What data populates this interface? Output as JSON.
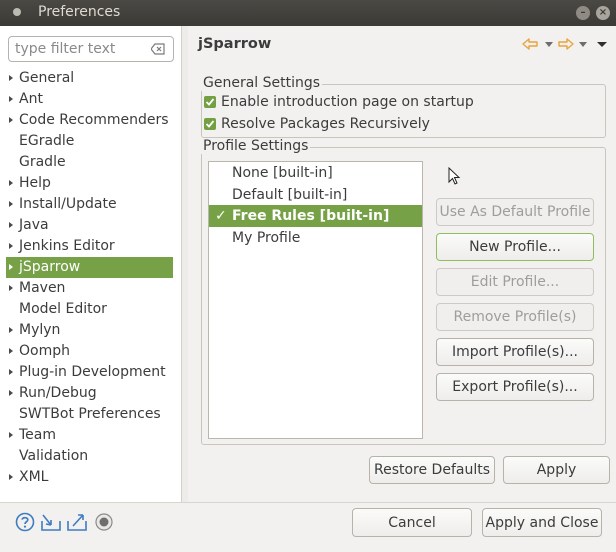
{
  "window": {
    "title": "Preferences"
  },
  "filter": {
    "placeholder": "type filter text"
  },
  "tree": [
    {
      "label": "General",
      "expandable": true
    },
    {
      "label": "Ant",
      "expandable": true
    },
    {
      "label": "Code Recommenders",
      "expandable": true
    },
    {
      "label": "EGradle",
      "expandable": false
    },
    {
      "label": "Gradle",
      "expandable": false
    },
    {
      "label": "Help",
      "expandable": true
    },
    {
      "label": "Install/Update",
      "expandable": true
    },
    {
      "label": "Java",
      "expandable": true
    },
    {
      "label": "Jenkins Editor",
      "expandable": true
    },
    {
      "label": "jSparrow",
      "expandable": true,
      "selected": true
    },
    {
      "label": "Maven",
      "expandable": true
    },
    {
      "label": "Model Editor",
      "expandable": false
    },
    {
      "label": "Mylyn",
      "expandable": true
    },
    {
      "label": "Oomph",
      "expandable": true
    },
    {
      "label": "Plug-in Development",
      "expandable": true
    },
    {
      "label": "Run/Debug",
      "expandable": true
    },
    {
      "label": "SWTBot Preferences",
      "expandable": false
    },
    {
      "label": "Team",
      "expandable": true
    },
    {
      "label": "Validation",
      "expandable": false
    },
    {
      "label": "XML",
      "expandable": true
    }
  ],
  "page": {
    "title": "jSparrow",
    "general_settings": {
      "label": "General Settings",
      "enable_intro_label": "Enable introduction page on startup",
      "resolve_packages_label": "Resolve Packages Recursively"
    },
    "profile_settings": {
      "label": "Profile Settings",
      "profiles": [
        {
          "label": "None [built-in]",
          "selected": false
        },
        {
          "label": "Default [built-in]",
          "selected": false
        },
        {
          "label": "Free Rules [built-in]",
          "selected": true
        },
        {
          "label": "My Profile",
          "selected": false
        }
      ],
      "selected_mark": "✓",
      "buttons": {
        "use_default": "Use As Default Profile",
        "new_profile": "New Profile...",
        "edit_profile": "Edit Profile...",
        "remove_profile": "Remove Profile(s)",
        "import_profile": "Import Profile(s)...",
        "export_profile": "Export Profile(s)..."
      }
    },
    "restore_defaults": "Restore Defaults",
    "apply": "Apply"
  },
  "footer": {
    "cancel": "Cancel",
    "apply_and_close": "Apply and Close"
  },
  "colors": {
    "selection": "#77a147",
    "arrow_accent": "#e8a33d",
    "footer_icon": "#3f7cc0"
  }
}
